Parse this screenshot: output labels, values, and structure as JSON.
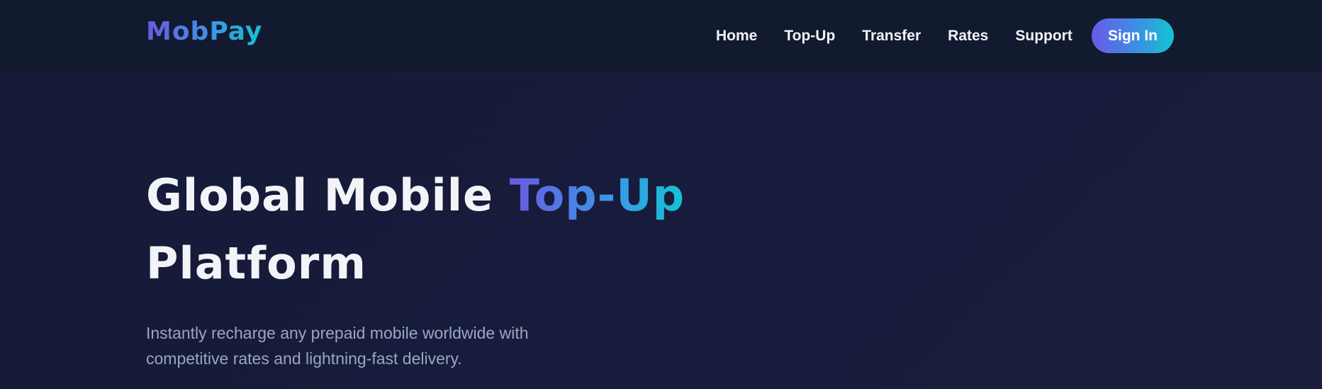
{
  "brand": {
    "logo_text": "MobPay"
  },
  "nav": {
    "items": [
      {
        "label": "Home"
      },
      {
        "label": "Top-Up"
      },
      {
        "label": "Transfer"
      },
      {
        "label": "Rates"
      },
      {
        "label": "Support"
      }
    ],
    "signin_label": "Sign In"
  },
  "hero": {
    "title_part1": "Global Mobile ",
    "title_accent": "Top-Up",
    "title_part2": "Platform",
    "subtitle": "Instantly recharge any prepaid mobile worldwide with competitive rates and lightning-fast delivery."
  },
  "colors": {
    "background": "#161b38",
    "navbar": "#121a2f",
    "accent_start": "#6a5ae0",
    "accent_end": "#14c3d3",
    "subtitle_text": "#9aa6c2"
  }
}
